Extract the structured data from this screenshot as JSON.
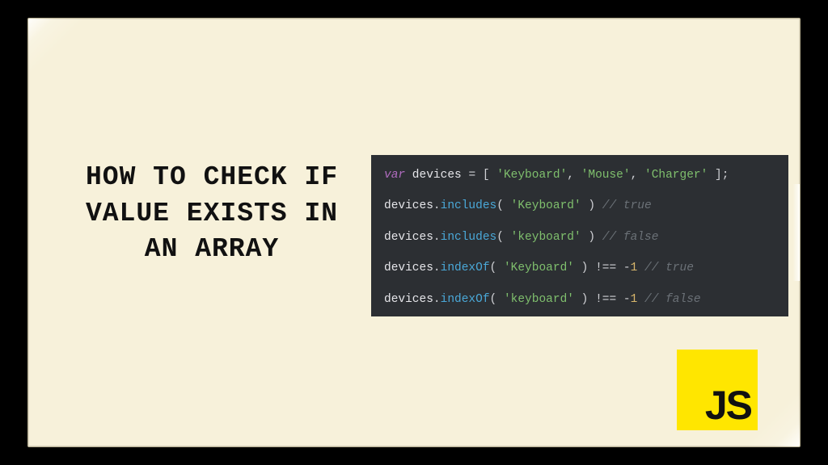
{
  "title": "HOW TO CHECK IF VALUE EXISTS IN AN ARRAY",
  "code": {
    "lines": [
      {
        "key": "var",
        "ident": " devices ",
        "op1": "=",
        "punc1": " [ ",
        "s1": "'Keyboard'",
        "c1": ", ",
        "s2": "'Mouse'",
        "c2": ", ",
        "s3": "'Charger'",
        "punc2": " ];"
      },
      {
        "ident": "devices",
        "dot": ".",
        "func": "includes",
        "open": "( ",
        "arg": "'Keyboard'",
        "close": " )",
        "space": " ",
        "cmt": "// true"
      },
      {
        "ident": "devices",
        "dot": ".",
        "func": "includes",
        "open": "( ",
        "arg": "'keyboard'",
        "close": " )",
        "space": " ",
        "cmt": "// false"
      },
      {
        "ident": "devices",
        "dot": ".",
        "func": "indexOf",
        "open": "( ",
        "arg": "'Keyboard'",
        "close": " ) ",
        "op": "!==",
        "sp2": " ",
        "neg": "-",
        "num": "1",
        "sp3": " ",
        "cmt": "// true"
      },
      {
        "ident": "devices",
        "dot": ".",
        "func": "indexOf",
        "open": "( ",
        "arg": "'keyboard'",
        "close": " ) ",
        "op": "!==",
        "sp2": " ",
        "neg": "-",
        "num": "1",
        "sp3": " ",
        "cmt": "// false"
      }
    ]
  },
  "badge": {
    "text": "JS"
  }
}
